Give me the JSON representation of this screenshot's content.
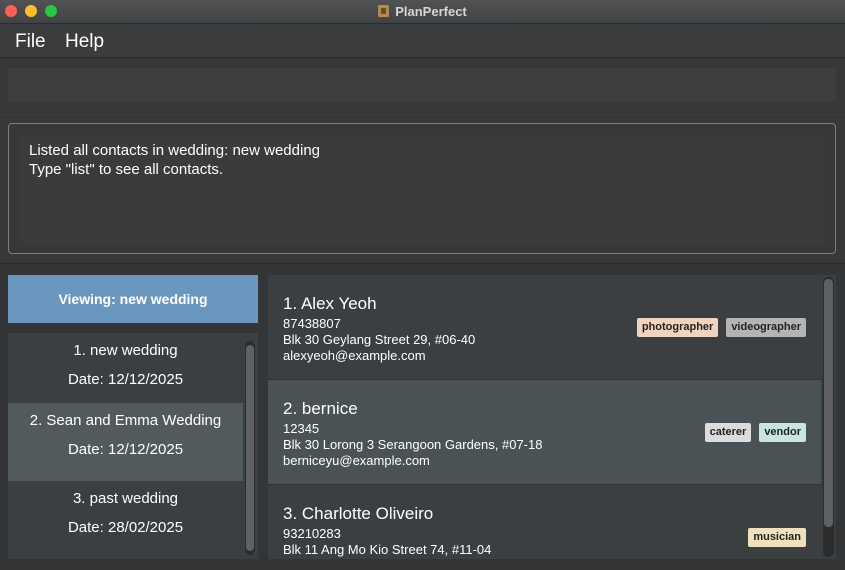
{
  "window": {
    "title": "PlanPerfect"
  },
  "menu": {
    "items": [
      "File",
      "Help"
    ]
  },
  "command": {
    "value": "",
    "placeholder": ""
  },
  "result": {
    "lines": [
      "Listed all contacts in wedding: new wedding",
      "Type \"list\" to see all contacts."
    ]
  },
  "viewing": {
    "label": "Viewing: new wedding"
  },
  "weddings": [
    {
      "name": "1. new wedding",
      "date": "Date: 12/12/2025"
    },
    {
      "name": "2. Sean and Emma Wedding",
      "date": "Date: 12/12/2025"
    },
    {
      "name": "3. past wedding",
      "date": "Date: 28/02/2025"
    }
  ],
  "contacts": [
    {
      "name": "1. Alex Yeoh",
      "phone": "87438807",
      "address": "Blk 30 Geylang Street 29, #06-40",
      "email": "alexyeoh@example.com",
      "tags": [
        {
          "label": "photographer",
          "color": "#f2d3bd"
        },
        {
          "label": "videographer",
          "color": "#b4b4b4"
        }
      ]
    },
    {
      "name": "2. bernice",
      "phone": "12345",
      "address": "Blk 30 Lorong 3 Serangoon Gardens, #07-18",
      "email": "berniceyu@example.com",
      "tags": [
        {
          "label": "caterer",
          "color": "#dcdcdc"
        },
        {
          "label": "vendor",
          "color": "#c9e5df"
        }
      ]
    },
    {
      "name": "3. Charlotte Oliveiro",
      "phone": "93210283",
      "address": "Blk 11 Ang Mo Kio Street 74, #11-04",
      "email": "",
      "tags": [
        {
          "label": "musician",
          "color": "#efe1bd"
        }
      ]
    }
  ],
  "colors": {
    "viewing_bg": "#6a97bd",
    "selected_wedding": "#535a5e",
    "selected_contact": "#4b5256"
  }
}
